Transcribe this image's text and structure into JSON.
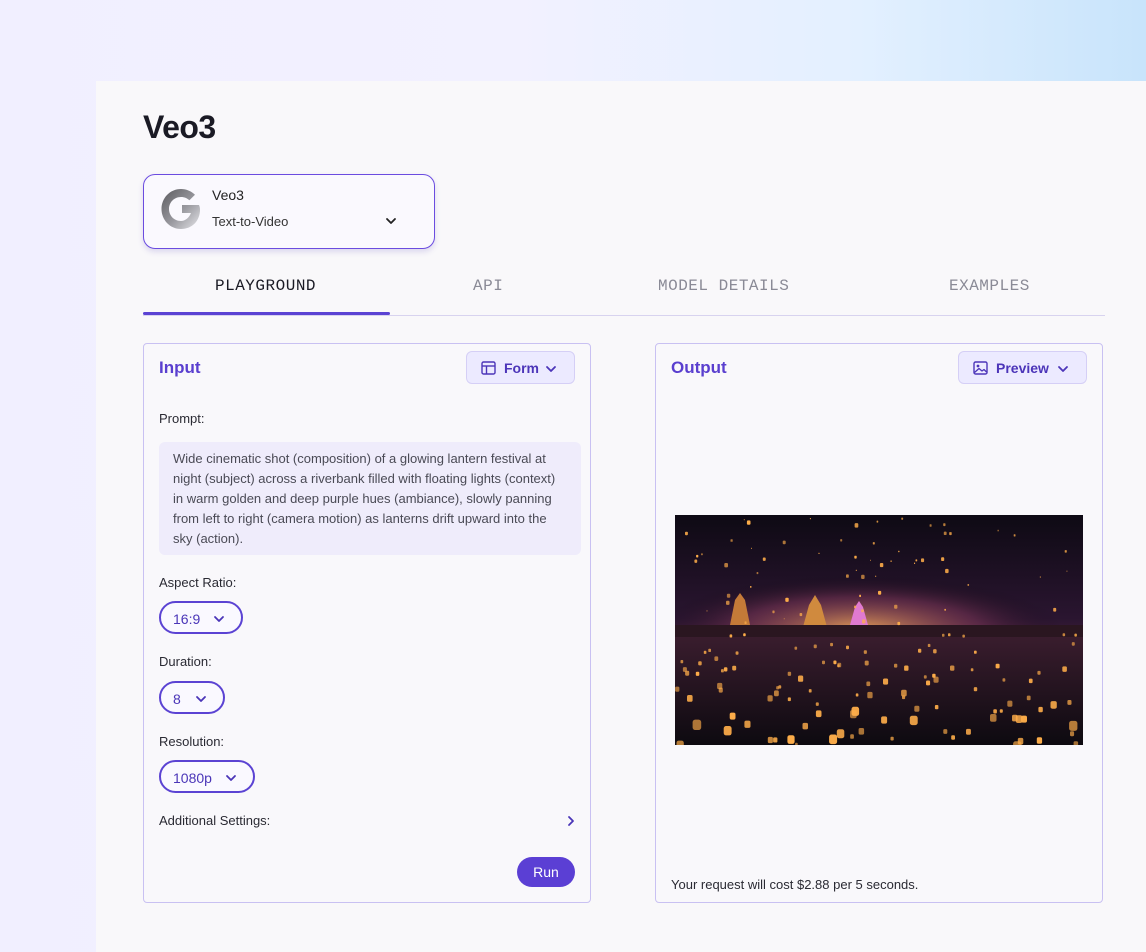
{
  "page": {
    "title": "Veo3"
  },
  "model_selector": {
    "name": "Veo3",
    "type": "Text-to-Video",
    "logo_icon": "google-g-icon",
    "chevron_icon": "chevron-down-icon"
  },
  "tabs": [
    {
      "label": "PLAYGROUND",
      "active": true
    },
    {
      "label": "API",
      "active": false
    },
    {
      "label": "MODEL DETAILS",
      "active": false
    },
    {
      "label": "EXAMPLES",
      "active": false
    }
  ],
  "input_panel": {
    "title": "Input",
    "mode_button": {
      "label": "Form",
      "icon": "table-icon"
    },
    "prompt": {
      "label": "Prompt:",
      "value": "Wide cinematic shot (composition) of a glowing lantern festival at night (subject) across a riverbank filled with floating lights (context) in warm golden and deep purple hues (ambiance), slowly panning from left to right (camera motion) as lanterns drift upward into the sky (action)."
    },
    "aspect_ratio": {
      "label": "Aspect Ratio:",
      "value": "16:9"
    },
    "duration": {
      "label": "Duration:",
      "value": "8"
    },
    "resolution": {
      "label": "Resolution:",
      "value": "1080p"
    },
    "additional_settings": {
      "label": "Additional Settings:",
      "icon": "chevron-right-icon"
    },
    "run_button": {
      "label": "Run"
    }
  },
  "output_panel": {
    "title": "Output",
    "mode_button": {
      "label": "Preview",
      "icon": "image-icon"
    },
    "cost_text": "Your request will cost $2.88 per 5 seconds."
  },
  "colors": {
    "accent": "#5b43d3",
    "accent_text": "#5a3fcf",
    "panel_border": "#c9c1f2"
  }
}
